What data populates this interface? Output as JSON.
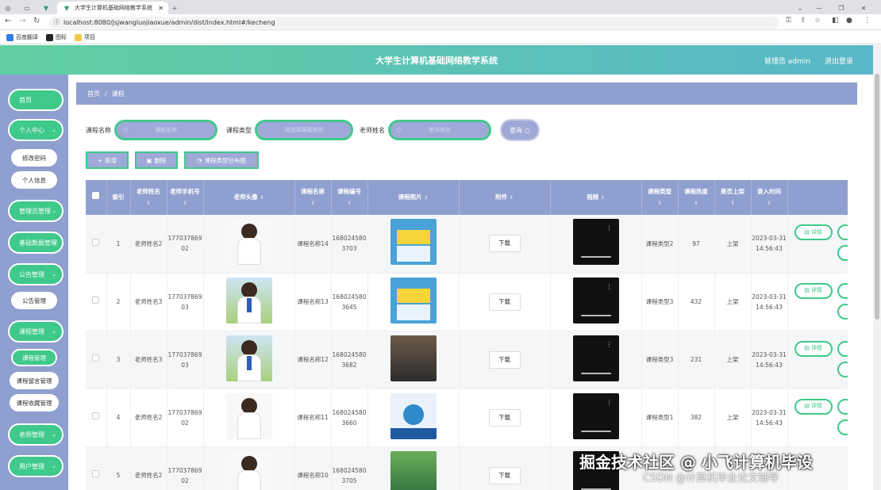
{
  "browser": {
    "tab_title": "大学生计算机基础网络教学系统",
    "url": "localhost:8080/jsjwangluojiaoxue/admin/dist/index.html#/kecheng",
    "bookmarks": [
      "百度翻译",
      "图标",
      "项目"
    ]
  },
  "header": {
    "title": "大学生计算机基础网络教学系统",
    "user": "管理员 admin",
    "logout": "退出登录"
  },
  "sidebar": {
    "items": [
      {
        "label": "首页"
      },
      {
        "label": "个人中心"
      },
      {
        "label": "修改密码"
      },
      {
        "label": "个人信息"
      },
      {
        "label": "管理员管理"
      },
      {
        "label": "基础数据管理"
      },
      {
        "label": "公告管理"
      },
      {
        "label": "公告管理"
      },
      {
        "label": "课程管理"
      },
      {
        "label": "课程管理"
      },
      {
        "label": "课程留言管理"
      },
      {
        "label": "课程收藏管理"
      },
      {
        "label": "老师管理"
      },
      {
        "label": "用户管理"
      }
    ]
  },
  "breadcrumb": {
    "home": "首页",
    "sep": "/",
    "current": "课程"
  },
  "filters": {
    "course_name_label": "课程名称",
    "course_name_placeholder": "课程名称",
    "course_type_label": "课程类型",
    "course_type_placeholder": "请选择课程类型",
    "teacher_name_label": "老师姓名",
    "teacher_name_placeholder": "老师姓名",
    "search": "查询"
  },
  "actions": {
    "add": "新增",
    "delete": "删除",
    "chart": "课程类型分布图"
  },
  "table": {
    "headers": [
      "索引",
      "老师姓名",
      "老师手机号",
      "老师头像",
      "课程名称",
      "课程编号",
      "课程照片",
      "附件",
      "视频",
      "课程类型",
      "课程热度",
      "是否上架",
      "录入时间"
    ],
    "download_label": "下载",
    "detail_label": "详情",
    "rows": [
      {
        "index": "1",
        "teacher": "老师姓名2",
        "phone": "17703786902",
        "course": "课程名称14",
        "code": "1680245803703",
        "type": "课程类型2",
        "heat": "97",
        "status": "上架",
        "time": "2023-03-31 14:56:43"
      },
      {
        "index": "2",
        "teacher": "老师姓名3",
        "phone": "17703786903",
        "course": "课程名称13",
        "code": "1680245803645",
        "type": "课程类型3",
        "heat": "432",
        "status": "上架",
        "time": "2023-03-31 14:56:43"
      },
      {
        "index": "3",
        "teacher": "老师姓名3",
        "phone": "17703786903",
        "course": "课程名称12",
        "code": "1680245803682",
        "type": "课程类型3",
        "heat": "231",
        "status": "上架",
        "time": "2023-03-31 14:56:43"
      },
      {
        "index": "4",
        "teacher": "老师姓名2",
        "phone": "17703786902",
        "course": "课程名称11",
        "code": "1680245803660",
        "type": "课程类型1",
        "heat": "382",
        "status": "上架",
        "time": "2023-03-31 14:56:43"
      },
      {
        "index": "5",
        "teacher": "老师姓名2",
        "phone": "17703786902",
        "course": "课程名称10",
        "code": "1680245803705",
        "type": "",
        "heat": "",
        "status": "",
        "time": ""
      }
    ]
  },
  "watermark": {
    "line1": "掘金技术社区 @ 小飞计算机毕设",
    "line2": "CSDN @计算机毕业论文辅导"
  }
}
